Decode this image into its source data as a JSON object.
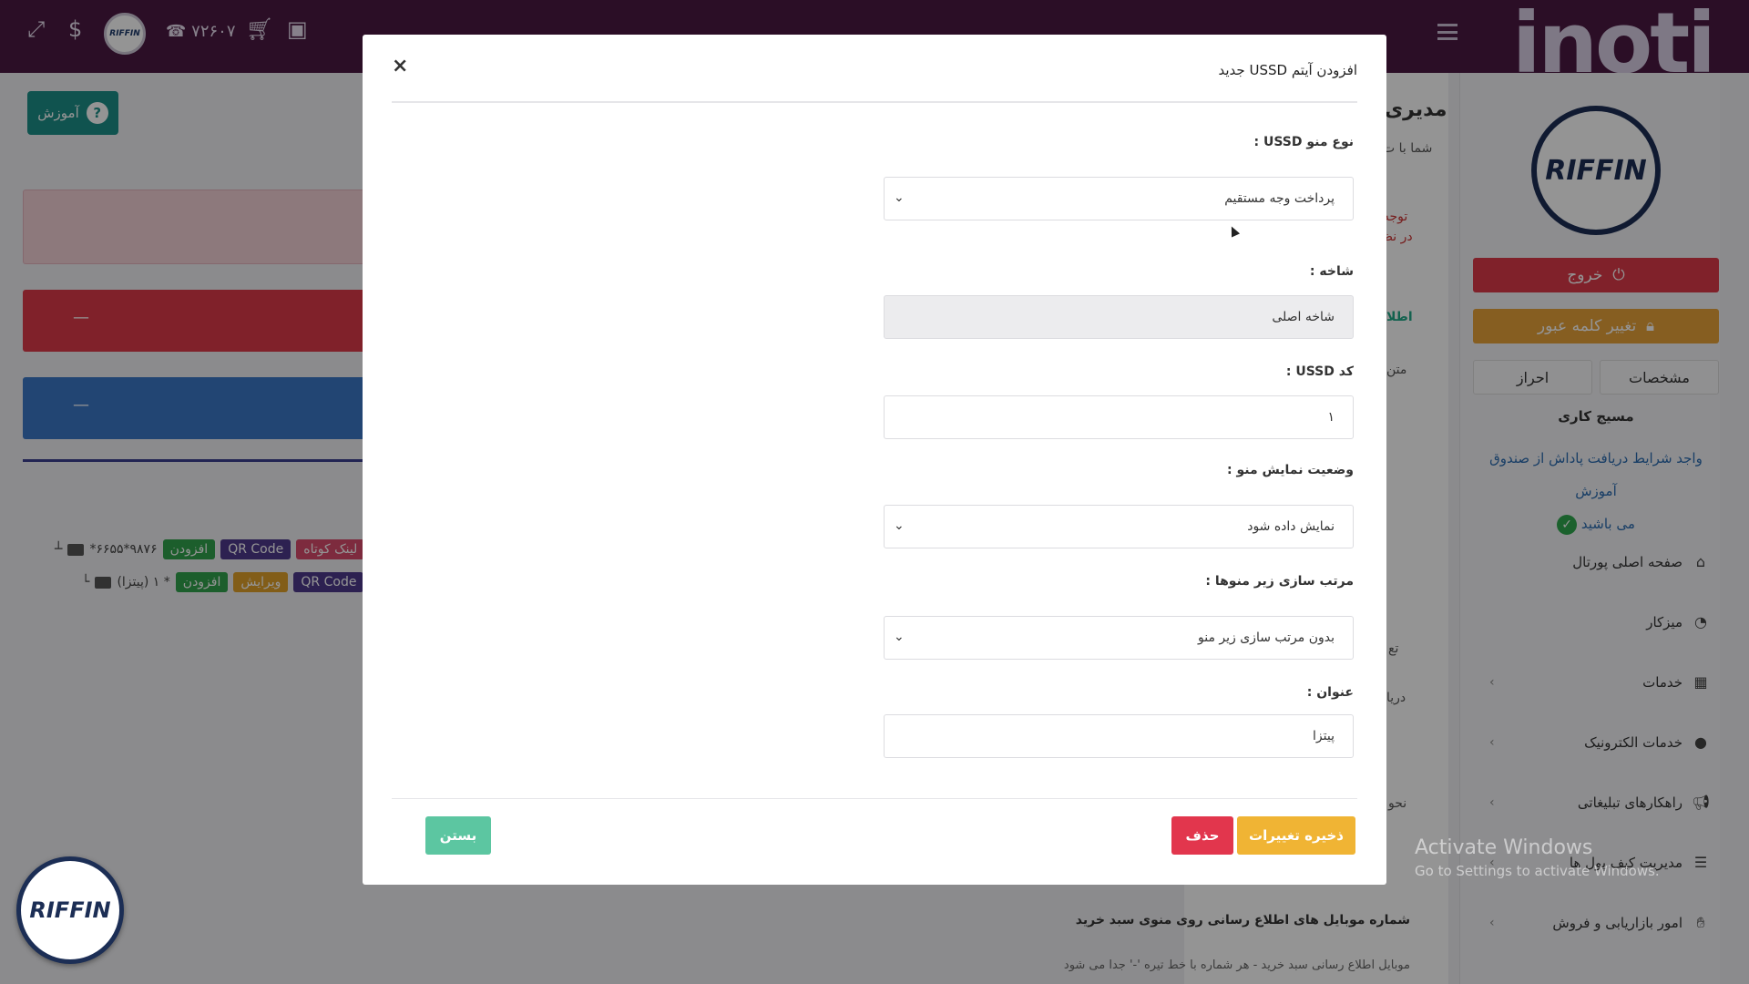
{
  "topbar": {
    "phone": "۷۲۶۰۷",
    "brand": "inoti",
    "avatar_text": "RIFFIN"
  },
  "left": {
    "help_label": "آموزش",
    "red_bar_text": "—",
    "blue_bar_text": "—",
    "tree": [
      {
        "label": "*۶۶۵۵*۹۸۷۶",
        "add": "افزودن",
        "qr": "QR Code",
        "extra": "لینک کوتاه"
      },
      {
        "label": "(پیتزا) ۱ *",
        "add": "افزودن",
        "edit": "ویرایش",
        "qr": "QR Code"
      }
    ]
  },
  "background_page": {
    "title": "مدیری",
    "subtitle": "شما با ت",
    "note_1": "توجه",
    "note_2": "در نظ",
    "info": "اطلا",
    "text_1": "متن",
    "label_3": "تع",
    "label_4": "دریا",
    "label_5": "نحو",
    "buyer_mobile_heading": "شماره موبایل های اطلاع رسانی روی منوی سبد خرید",
    "buyer_mobile_placeholder": "موبایل اطلاع رسانی سبد خرید - هر شماره با خط تیره '-' جدا می شود"
  },
  "sidebar": {
    "logo_text": "RIFFIN",
    "logout": "خروج",
    "change_password": "تغییر کلمه عبور",
    "tab_profile": "مشخصات",
    "tab_auth": "احراز",
    "career_path": "مسیج کاری",
    "reward_text": "واجد شرایط دریافت پاداش از صندوق آموزش",
    "reward_suffix": "می باشید",
    "menu": [
      {
        "label": "صفحه اصلی پورتال",
        "icon": "home-icon",
        "chevron": false
      },
      {
        "label": "میزکار",
        "icon": "dashboard-icon",
        "chevron": false
      },
      {
        "label": "خدمات",
        "icon": "services-icon",
        "chevron": true
      },
      {
        "label": "خدمات الکترونیک",
        "icon": "globe-icon",
        "chevron": true
      },
      {
        "label": "راهکارهای تبلیغاتی",
        "icon": "megaphone-icon",
        "chevron": true
      },
      {
        "label": "مدیریت کیف پول ها",
        "icon": "wallet-icon",
        "chevron": true
      },
      {
        "label": "امور بازاریابی و فروش",
        "icon": "handshake-icon",
        "chevron": true
      }
    ]
  },
  "modal": {
    "title": "افزودن آیتم USSD جدید",
    "close_icon": "×",
    "fields": {
      "menu_type": {
        "label": "نوع منو USSD :",
        "value": "پرداخت وجه مستقیم"
      },
      "branch": {
        "label": "شاخه :",
        "value": "شاخه اصلی"
      },
      "ussd_code": {
        "label": "کد USSD :",
        "value": "۱"
      },
      "display_status": {
        "label": "وضعیت نمایش منو :",
        "value": "نمایش داده شود"
      },
      "submenu_sort": {
        "label": "مرتب سازی زیر منوها :",
        "value": "بدون مرتب سازی زیر منو"
      },
      "title": {
        "label": "عنوان :",
        "value": "پیتزا"
      }
    },
    "buttons": {
      "save": "ذخیره تغییرات",
      "delete": "حذف",
      "close": "بستن"
    }
  },
  "watermark": {
    "line1": "Activate Windows",
    "line2": "Go to Settings to activate Windows."
  },
  "floating_logo_text": "RIFFIN"
}
